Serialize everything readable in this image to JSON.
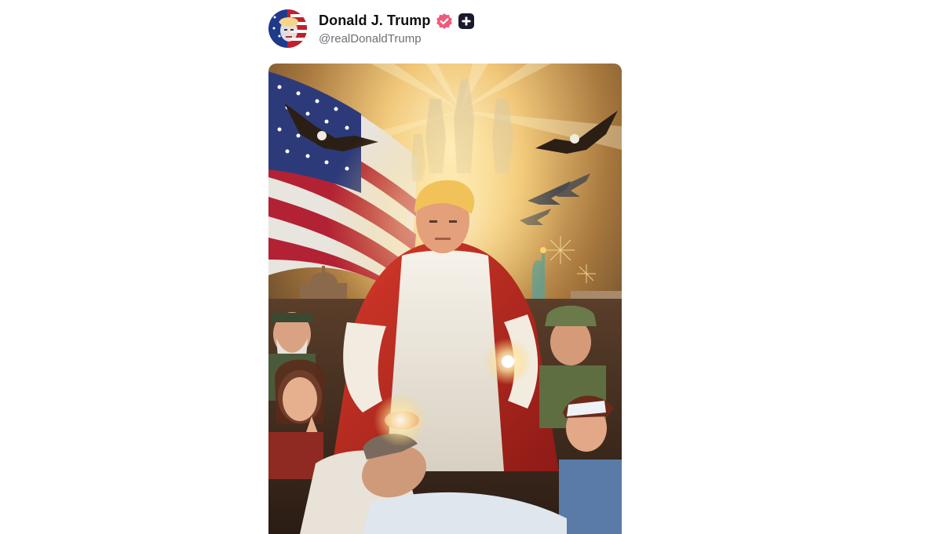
{
  "post": {
    "author": {
      "display_name": "Donald J. Trump",
      "handle": "@realDonaldTrump",
      "verified_icon": "verified-badge-icon",
      "extra_badge_icon": "plus-badge-icon",
      "avatar_icon": "profile-avatar"
    },
    "media": {
      "type": "illustration",
      "accent_colors": [
        "#b22234",
        "#3c3b6e",
        "#f4c25a",
        "#ffffff"
      ]
    }
  },
  "colors": {
    "name": "#111111",
    "handle": "#6e6e75",
    "verified": "#ef5b7b",
    "plus_badge": "#1a1a2e"
  }
}
